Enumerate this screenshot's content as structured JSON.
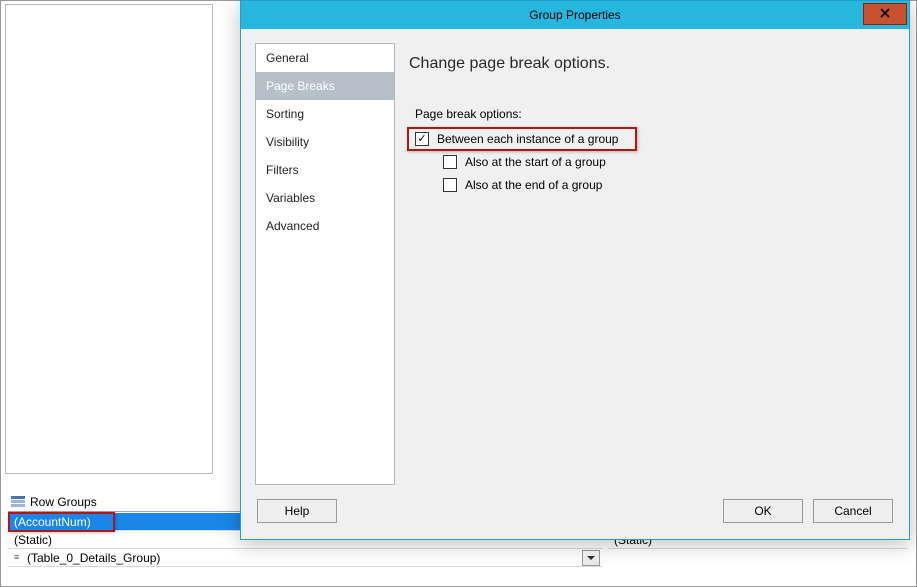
{
  "dialog": {
    "title": "Group Properties",
    "close_icon": "x",
    "nav": {
      "items": [
        {
          "label": "General"
        },
        {
          "label": "Page Breaks"
        },
        {
          "label": "Sorting"
        },
        {
          "label": "Visibility"
        },
        {
          "label": "Filters"
        },
        {
          "label": "Variables"
        },
        {
          "label": "Advanced"
        }
      ],
      "selected_index": 1
    },
    "content": {
      "heading": "Change page break options.",
      "section_label": "Page break options:",
      "opt_between": "Between each instance of a group",
      "opt_start": "Also at the start of a group",
      "opt_end": "Also at the end of a group",
      "opt_between_checked": true,
      "opt_start_checked": false,
      "opt_end_checked": false
    },
    "buttons": {
      "help": "Help",
      "ok": "OK",
      "cancel": "Cancel"
    }
  },
  "groups_panel": {
    "header": "Row Groups",
    "items": [
      {
        "label": "(AccountNum)",
        "selected": true
      },
      {
        "label": "(Static)"
      },
      {
        "label": "(Table_0_Details_Group)",
        "is_details": true,
        "has_dropdown": true
      }
    ],
    "right_col_item": "(Static)"
  }
}
